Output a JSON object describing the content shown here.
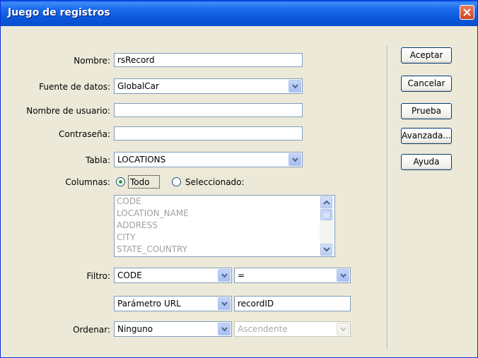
{
  "window": {
    "title": "Juego de registros"
  },
  "form": {
    "nombre": {
      "label": "Nombre:",
      "value": "rsRecord"
    },
    "fuente": {
      "label": "Fuente de datos:",
      "value": "GlobalCar"
    },
    "usuario": {
      "label": "Nombre de usuario:",
      "value": ""
    },
    "contrasena": {
      "label": "Contraseña:",
      "value": ""
    },
    "tabla": {
      "label": "Tabla:",
      "value": "LOCATIONS"
    },
    "columnas": {
      "label": "Columnas:",
      "option_todo": "Todo",
      "option_seleccionado": "Seleccionado:",
      "selected": "Todo",
      "items": [
        "CODE",
        "LOCATION_NAME",
        "ADDRESS",
        "CITY",
        "STATE_COUNTRY"
      ]
    },
    "filtro": {
      "label": "Filtro:",
      "column": "CODE",
      "operator": "=",
      "param_type": "Parámetro URL",
      "param_value": "recordID"
    },
    "ordenar": {
      "label": "Ordenar:",
      "value": "Ninguno",
      "direction": "Ascendente"
    }
  },
  "buttons": {
    "aceptar": "Aceptar",
    "cancelar": "Cancelar",
    "prueba": "Prueba",
    "avanzada": "Avanzada...",
    "ayuda": "Ayuda"
  },
  "colors": {
    "titlebar": "#0a56d8",
    "dialog_bg": "#ece9d8",
    "close": "#d2441a"
  }
}
